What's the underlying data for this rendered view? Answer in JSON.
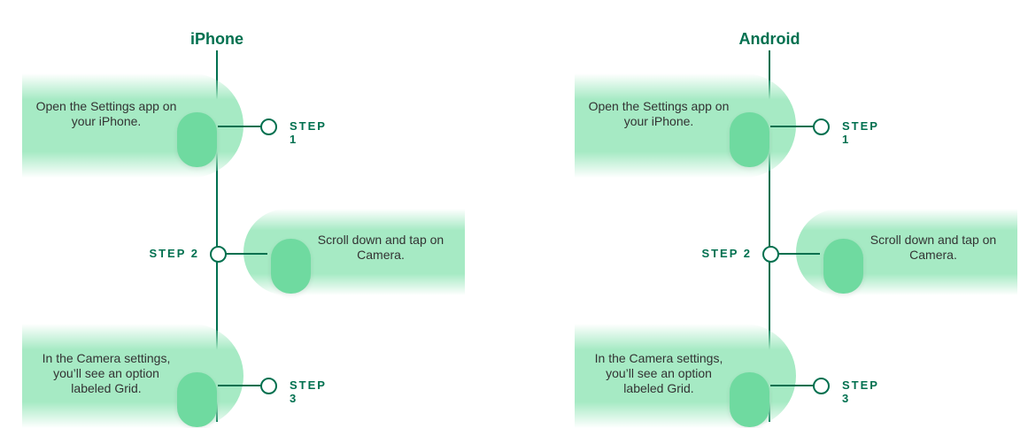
{
  "colors": {
    "line": "#00704f",
    "band": "#a6eac4",
    "pill": "#6fdaa0"
  },
  "columns": [
    {
      "title": "iPhone",
      "steps": [
        {
          "label": "STEP 1",
          "text": "Open the Settings app on your iPhone."
        },
        {
          "label": "STEP 2",
          "text": "Scroll down and tap on Camera."
        },
        {
          "label": "STEP 3",
          "text": "In the Camera settings, you’ll see an option labeled Grid."
        }
      ]
    },
    {
      "title": "Android",
      "steps": [
        {
          "label": "STEP 1",
          "text": "Open the Settings app on your iPhone."
        },
        {
          "label": "STEP 2",
          "text": "Scroll down and tap on Camera."
        },
        {
          "label": "STEP 3",
          "text": "In the Camera settings, you’ll see an option labeled Grid."
        }
      ]
    }
  ]
}
